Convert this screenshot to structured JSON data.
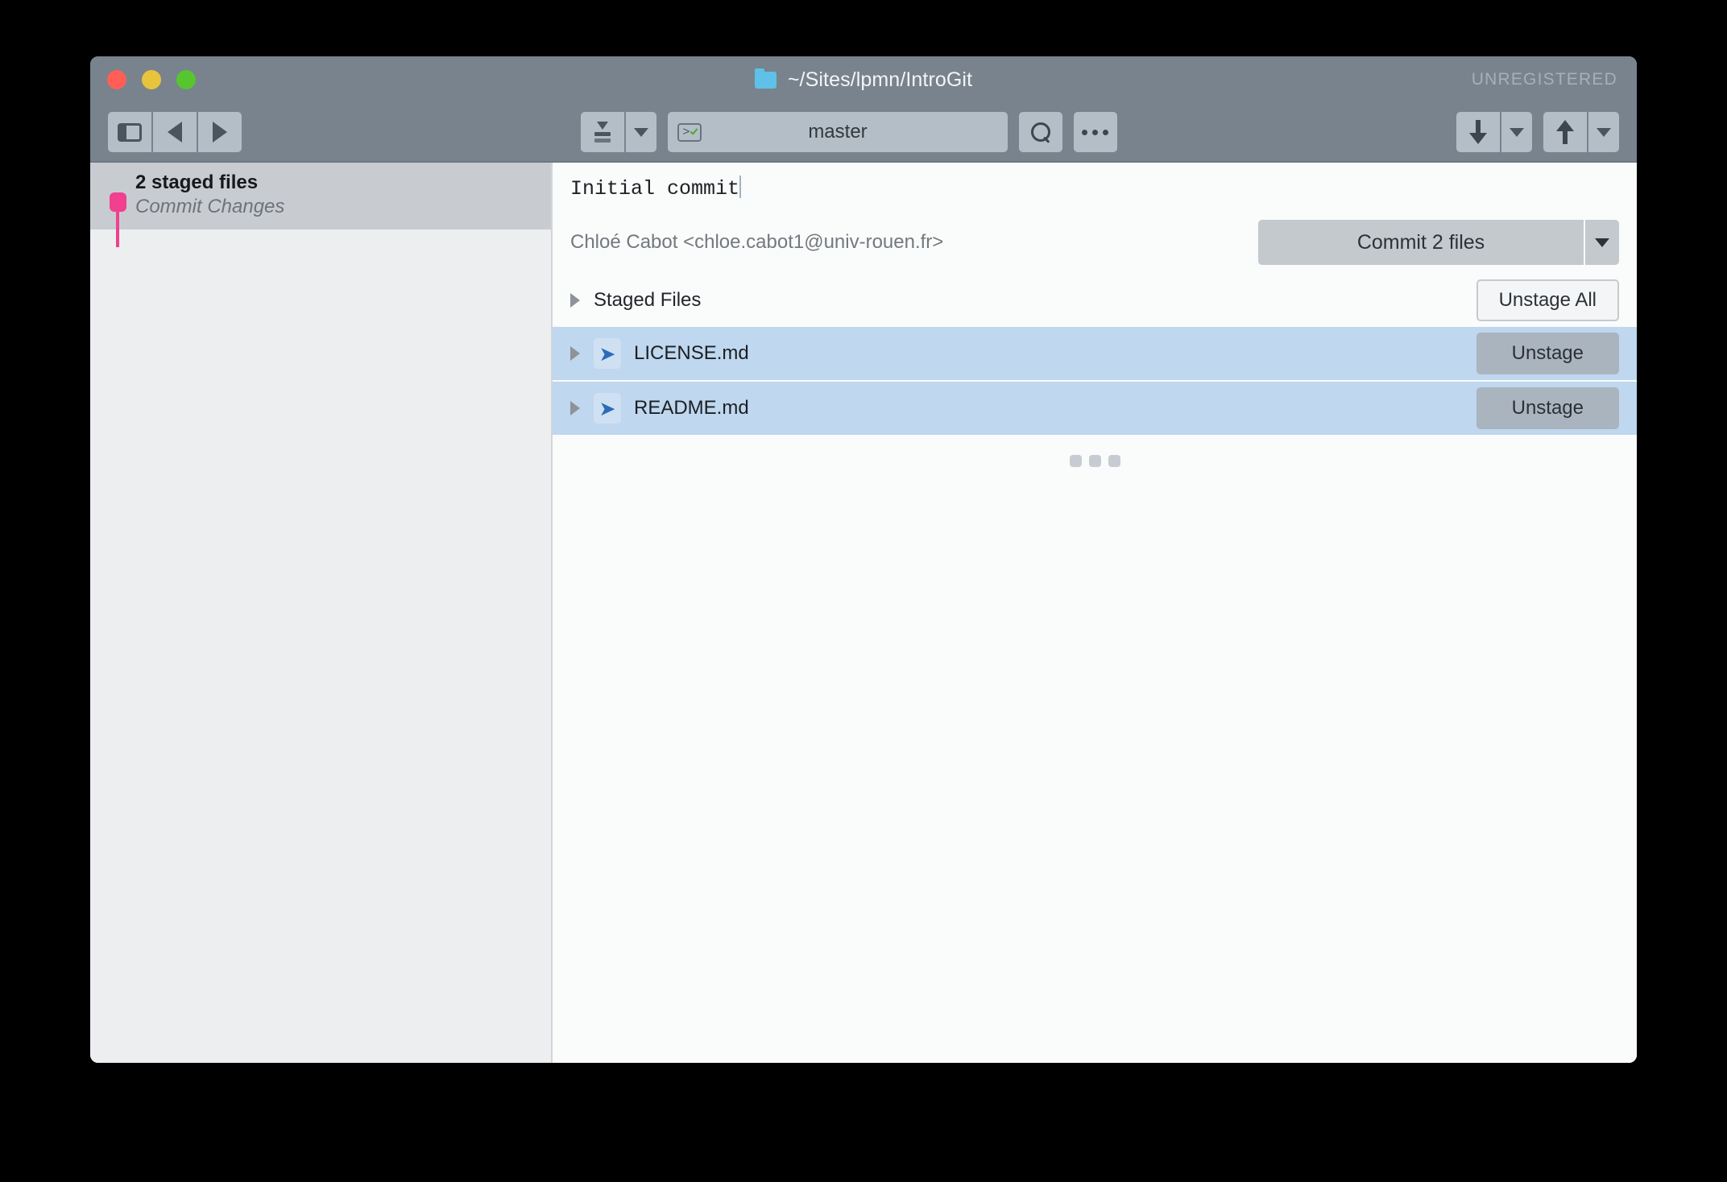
{
  "window": {
    "title": "~/Sites/lpmn/IntroGit",
    "folder_icon": "folder-icon",
    "license_status": "UNREGISTERED",
    "traffic_lights": {
      "close": "close-button",
      "minimize": "minimize-button",
      "maximize": "maximize-button"
    }
  },
  "toolbar": {
    "sidebar_toggle_icon": "sidebar-toggle-icon",
    "back_icon": "back-arrow-icon",
    "forward_icon": "forward-arrow-icon",
    "stash_icon": "stash-icon",
    "stash_dropdown_icon": "chevron-down-icon",
    "terminal_check_icon": "terminal-check-icon",
    "branch_name": "master",
    "search_icon": "search-icon",
    "more_icon": "more-options-icon",
    "pull_icon": "pull-down-arrow-icon",
    "pull_dropdown_icon": "chevron-down-icon",
    "push_icon": "push-up-arrow-icon",
    "push_dropdown_icon": "chevron-down-icon"
  },
  "sidebar": {
    "selected_row": {
      "primary": "2 staged files",
      "secondary": "Commit Changes",
      "node_color": "#f0408f"
    }
  },
  "main": {
    "commit_message": "Initial commit",
    "author": "Chloé Cabot <chloe.cabot1@univ-rouen.fr>",
    "commit_button_label": "Commit 2 files",
    "commit_button_dropdown_icon": "chevron-down-icon",
    "staged_section": {
      "title": "Staged Files",
      "disclosure_icon": "disclosure-triangle-icon",
      "unstage_all_label": "Unstage All"
    },
    "files": [
      {
        "name": "LICENSE.md",
        "status_icon": "new-file-chevron-icon",
        "disclosure_icon": "disclosure-triangle-icon",
        "action_label": "Unstage"
      },
      {
        "name": "README.md",
        "status_icon": "new-file-chevron-icon",
        "disclosure_icon": "disclosure-triangle-icon",
        "action_label": "Unstage"
      }
    ],
    "resize_handle_icon": "resize-grip-icon"
  },
  "colors": {
    "titlebar": "#78838e",
    "selection_blue": "#bfd7ef",
    "graph_node_pink": "#f0408f",
    "accent_blue": "#2b6cb5"
  }
}
